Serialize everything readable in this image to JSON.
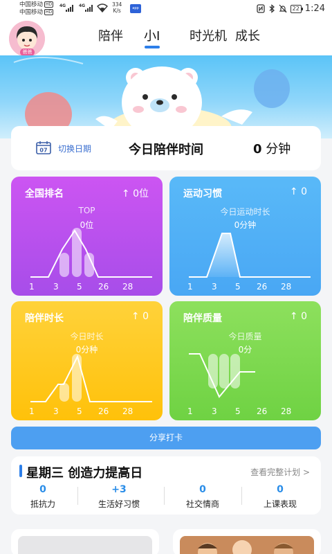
{
  "status": {
    "carrier1": "中国移动",
    "carrier2": "中国移动",
    "hd": "HD",
    "net": "4G",
    "speed_value": "334",
    "speed_unit": "K/s",
    "battery": "22",
    "time": "1:24"
  },
  "avatar": {
    "badge": "爸爸"
  },
  "nav": {
    "tabs": [
      "陪伴",
      "小I",
      "时光机",
      "成长"
    ],
    "active_index": 1
  },
  "time_card": {
    "switch_date": "切换日期",
    "calendar_day": "07",
    "title": "今日陪伴时间",
    "value": "0",
    "unit": "分钟"
  },
  "cards": [
    {
      "title": "全国排名",
      "rank_arrow": "↑",
      "rank": "0位",
      "sub1": "TOP",
      "sub2": "0位",
      "color": "#b64fee"
    },
    {
      "title": "运动习惯",
      "rank_arrow": "↑",
      "rank": "0",
      "sub1": "今日运动时长",
      "sub2": "0分钟",
      "color": "#52b0f6"
    },
    {
      "title": "陪伴时长",
      "rank_arrow": "↑",
      "rank": "0",
      "sub1": "今日时长",
      "sub2": "0分种",
      "color": "#ffc722"
    },
    {
      "title": "陪伴质量",
      "rank_arrow": "↑",
      "rank": "0",
      "sub1": "今日质量",
      "sub2": "0分",
      "color": "#79d64c"
    }
  ],
  "ticks": [
    "1",
    "3",
    "5",
    "26",
    "28"
  ],
  "share_button": "分享打卡",
  "plan": {
    "title": "星期三 创造力提高日",
    "link": "查看完整计划 >",
    "metrics": [
      {
        "value": "0",
        "label": "抵抗力"
      },
      {
        "value": "+3",
        "label": "生活好习惯"
      },
      {
        "value": "0",
        "label": "社交情商"
      },
      {
        "value": "0",
        "label": "上课表现"
      }
    ]
  },
  "icons": [
    "nfc-icon",
    "bluetooth-icon",
    "mute-icon",
    "wifi-icon",
    "calendar-icon",
    "bear-mascot-icon",
    "balloon-icon"
  ]
}
